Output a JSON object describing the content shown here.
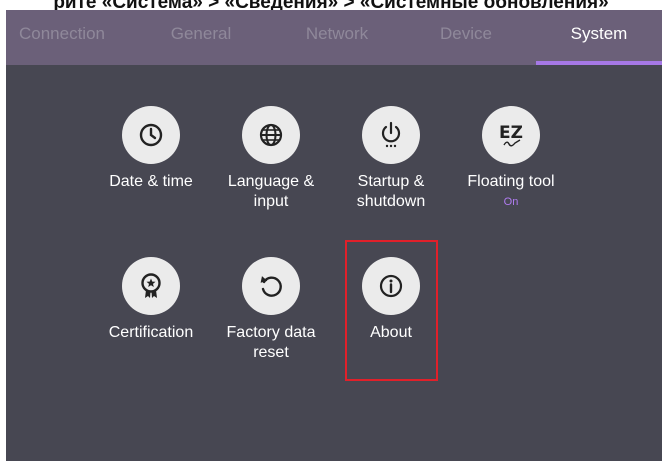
{
  "caption": "рите «Система» > «Сведения» > «Системные обновления»",
  "tabs": [
    {
      "label": "Connection",
      "active": false
    },
    {
      "label": "General",
      "active": false
    },
    {
      "label": "Network",
      "active": false
    },
    {
      "label": "Device",
      "active": false
    },
    {
      "label": "System",
      "active": true
    }
  ],
  "tiles": [
    {
      "label": "Date & time",
      "icon": "clock-icon"
    },
    {
      "label": "Language & input",
      "icon": "globe-icon"
    },
    {
      "label": "Startup & shutdown",
      "icon": "power-icon"
    },
    {
      "label": "Floating tool",
      "icon": "ez-pen-icon",
      "status": "On"
    },
    {
      "label": "Certification",
      "icon": "certification-badge-icon"
    },
    {
      "label": "Factory data reset",
      "icon": "reset-icon"
    },
    {
      "label": "About",
      "icon": "info-icon",
      "highlighted": true
    }
  ],
  "colors": {
    "tab_bar": "#6b6079",
    "background": "#474752",
    "accent": "#a678e6",
    "highlight_border": "#e1202a"
  }
}
